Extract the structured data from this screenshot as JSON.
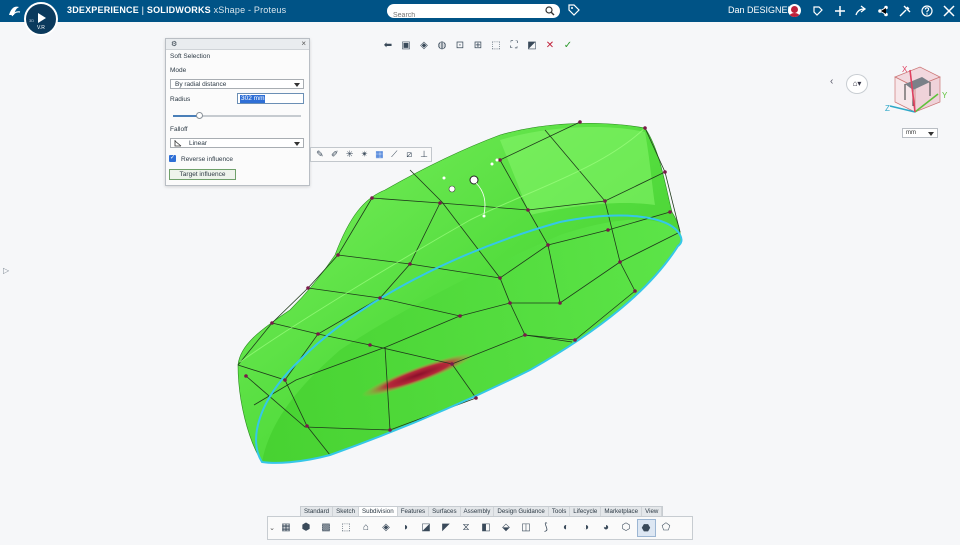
{
  "topbar": {
    "brand": "3DEXPERIENCE",
    "separator": " | ",
    "product": "SOLIDWORKS",
    "app": " xShape - Proteus",
    "compass_version": "V.R",
    "compass_3d": "3D",
    "compass_play": "▶",
    "search_placeholder": "Search",
    "user_name": "Dan DESIGNER",
    "bg_color": "#005386"
  },
  "soft_selection": {
    "title": "Soft Selection",
    "mode_label": "Mode",
    "mode_value": "By radial distance",
    "radius_label": "Radius",
    "radius_value": "302 mm",
    "radius_slider_fraction": 0.2,
    "falloff_label": "Falloff",
    "falloff_value": "Linear",
    "reverse_influence_label": "Reverse influence",
    "reverse_influence_checked": true,
    "target_button": "Target influence"
  },
  "view_options": {
    "unit": "mm"
  },
  "axes": {
    "x": "X",
    "y": "Y",
    "z": "Z"
  },
  "tabs": [
    "Standard",
    "Sketch",
    "Subdivision",
    "Features",
    "Surfaces",
    "Assembly",
    "Design Guidance",
    "Tools",
    "Lifecycle",
    "Marketplace",
    "View"
  ],
  "active_tab": "Subdivision",
  "colors": {
    "model_green": "#5ee64a",
    "edge_cyan": "#35c7e8",
    "influence_red": "#b01a3a",
    "accent_blue": "#2f6fd6"
  }
}
